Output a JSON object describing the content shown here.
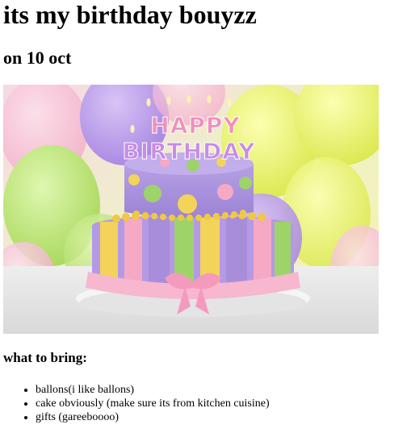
{
  "heading": "its my birthday bouyzz",
  "subheading": "on 10 oct",
  "cake_image": {
    "topper_line1": "HAPPY",
    "topper_line2": "BIRTHDAY",
    "colors": {
      "cake_purple": "#a98fd6",
      "cake_yellow": "#f3d35a",
      "cake_green": "#9ed36a",
      "cake_pink": "#f5a9c4",
      "balloon_yellow": "#e6f26a",
      "balloon_purple": "#b99be8"
    }
  },
  "bring_heading": "what to bring:",
  "bring_list": [
    "ballons(i like ballons)",
    "cake obviously (make sure its from kitchen cuisine)",
    "gifts (gareeboooo)"
  ]
}
